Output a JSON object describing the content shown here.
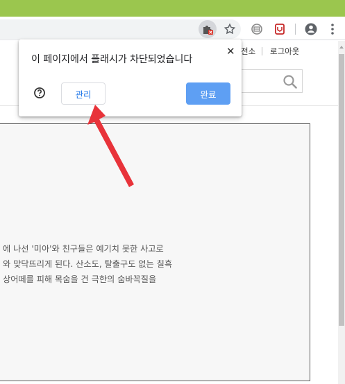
{
  "browser": {
    "toolbar_icons": [
      "flash-blocked-extension-icon",
      "star-icon",
      "extension-icon",
      "extension-red-icon",
      "account-icon",
      "menu-icon"
    ],
    "titlebar_color": "#9bc64e"
  },
  "page": {
    "nav_link_1": "전소",
    "nav_link_2": "로그아웃",
    "content_lines": [
      "에 나선 '미아'와 친구들은 예기치 못한 사고로",
      "와 맞닥뜨리게 된다. 산소도, 탈출구도 없는 칠흑",
      "상어떼를 피해 목숨을 건 극한의 숨바꼭질을"
    ]
  },
  "popup": {
    "title": "이 페이지에서 플래시가 차단되었습니다",
    "close_label": "✕",
    "manage_label": "관리",
    "done_label": "완료",
    "accent_color": "#1a73e8",
    "done_color": "#5e9ff3"
  },
  "annotation": {
    "arrow_color": "#e8333a"
  }
}
